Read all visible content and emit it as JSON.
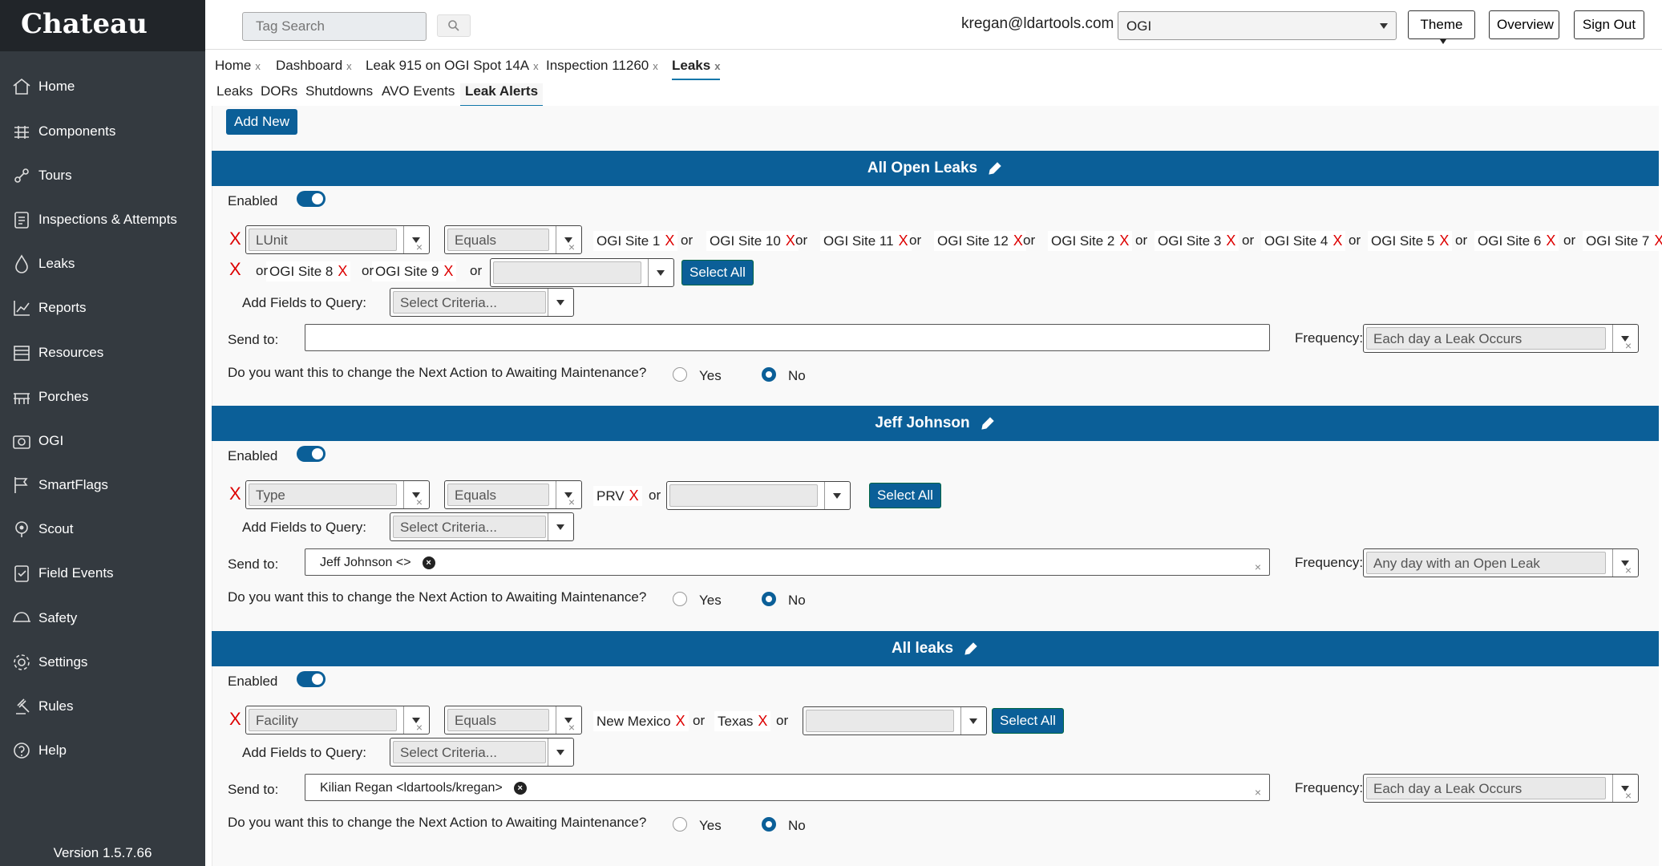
{
  "app": {
    "brand": "Chateau",
    "version": "Version 1.5.7.66"
  },
  "sidebar": {
    "items": [
      {
        "label": "Home",
        "icon": "home-icon"
      },
      {
        "label": "Components",
        "icon": "components-icon"
      },
      {
        "label": "Tours",
        "icon": "tours-icon"
      },
      {
        "label": "Inspections & Attempts",
        "icon": "clipboard-icon"
      },
      {
        "label": "Leaks",
        "icon": "leaks-icon"
      },
      {
        "label": "Reports",
        "icon": "chart-icon"
      },
      {
        "label": "Resources",
        "icon": "resources-icon"
      },
      {
        "label": "Porches",
        "icon": "porches-icon"
      },
      {
        "label": "OGI",
        "icon": "camera-icon"
      },
      {
        "label": "SmartFlags",
        "icon": "flag-icon"
      },
      {
        "label": "Scout",
        "icon": "scout-icon"
      },
      {
        "label": "Field Events",
        "icon": "field-events-icon"
      },
      {
        "label": "Safety",
        "icon": "safety-icon"
      },
      {
        "label": "Settings",
        "icon": "gear-icon"
      },
      {
        "label": "Rules",
        "icon": "gavel-icon"
      },
      {
        "label": "Help",
        "icon": "help-icon"
      }
    ]
  },
  "topbar": {
    "search_placeholder": "Tag Search",
    "user_email": "kregan@ldartools.com",
    "company": "OGI",
    "theme_label": "Theme",
    "overview_label": "Overview",
    "signout_label": "Sign Out"
  },
  "tabs": [
    {
      "label": "Home",
      "close": "x"
    },
    {
      "label": "Dashboard",
      "close": "x"
    },
    {
      "label": "Leak 915 on OGI Spot 14A",
      "close": "x"
    },
    {
      "label": "Inspection 11260",
      "close": "x"
    },
    {
      "label": "Leaks",
      "close": "x"
    }
  ],
  "subtabs": [
    "Leaks",
    "DORs",
    "Shutdowns",
    "AVO Events",
    "Leak Alerts"
  ],
  "add_new_label": "Add New",
  "common": {
    "enabled_label": "Enabled",
    "add_fields_label": "Add Fields to Query:",
    "criteria_placeholder": "Select Criteria...",
    "send_to_label": "Send to:",
    "frequency_label": "Frequency:",
    "question": "Do you want this to change the Next Action to Awaiting Maintenance?",
    "yes_label": "Yes",
    "no_label": "No",
    "select_all_label": "Select All",
    "remove_mark": "X",
    "or_label": "or",
    "clear_mark": "×"
  },
  "alerts": [
    {
      "title": "All Open Leaks",
      "field": "LUnit",
      "operator": "Equals",
      "values": [
        "OGI Site 1",
        "OGI Site 10",
        "OGI Site 11",
        "OGI Site 12",
        "OGI Site 2",
        "OGI Site 3",
        "OGI Site 4",
        "OGI Site 5",
        "OGI Site 6",
        "OGI Site 7",
        "OGI Site 8",
        "OGI Site 9"
      ],
      "recipient": "",
      "frequency": "Each day a Leak Occurs",
      "change_next_action": "No"
    },
    {
      "title": "Jeff Johnson",
      "field": "Type",
      "operator": "Equals",
      "values": [
        "PRV"
      ],
      "recipient": "Jeff Johnson <>",
      "frequency": "Any day with an Open Leak",
      "change_next_action": "No"
    },
    {
      "title": "All leaks",
      "field": "Facility",
      "operator": "Equals",
      "values": [
        "New Mexico",
        "Texas"
      ],
      "recipient": "Kilian Regan <ldartools/kregan>",
      "frequency": "Each day a Leak Occurs",
      "change_next_action": "No"
    }
  ],
  "colors": {
    "primary": "#0b5f98",
    "sidebar": "#343a40",
    "remove": "#dd0000"
  }
}
